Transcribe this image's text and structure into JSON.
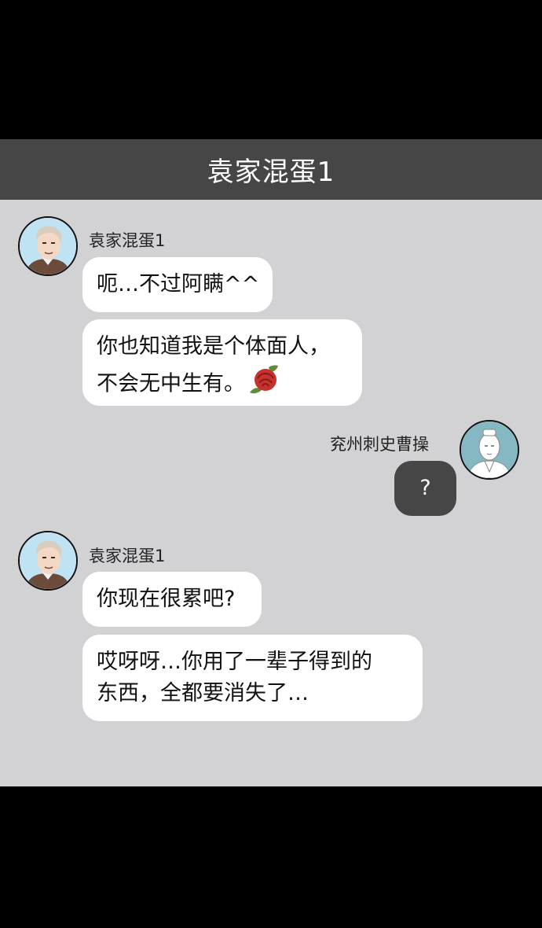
{
  "header": {
    "title": "袁家混蛋1"
  },
  "messages": [
    {
      "sender": "袁家混蛋1",
      "avatar": "man-avatar",
      "bubbles": [
        "呃…不过阿瞒^^",
        "你也知道我是个体面人，",
        "不会无中生有。"
      ]
    },
    {
      "sender": "兖州刺史曹操",
      "avatar": "robed-figure-avatar",
      "bubbles": [
        "?"
      ]
    },
    {
      "sender": "袁家混蛋1",
      "avatar": "man-avatar",
      "bubbles": [
        "你现在很累吧?",
        "哎呀呀…你用了一辈子得到的",
        "东西，全都要消失了…"
      ]
    }
  ],
  "icons": {
    "rose": "rose-sticker-icon"
  },
  "colors": {
    "background": "#000000",
    "header": "#464646",
    "chat_background": "#d2d1d4",
    "bubble_incoming": "#ffffff",
    "bubble_outgoing": "#464646"
  }
}
